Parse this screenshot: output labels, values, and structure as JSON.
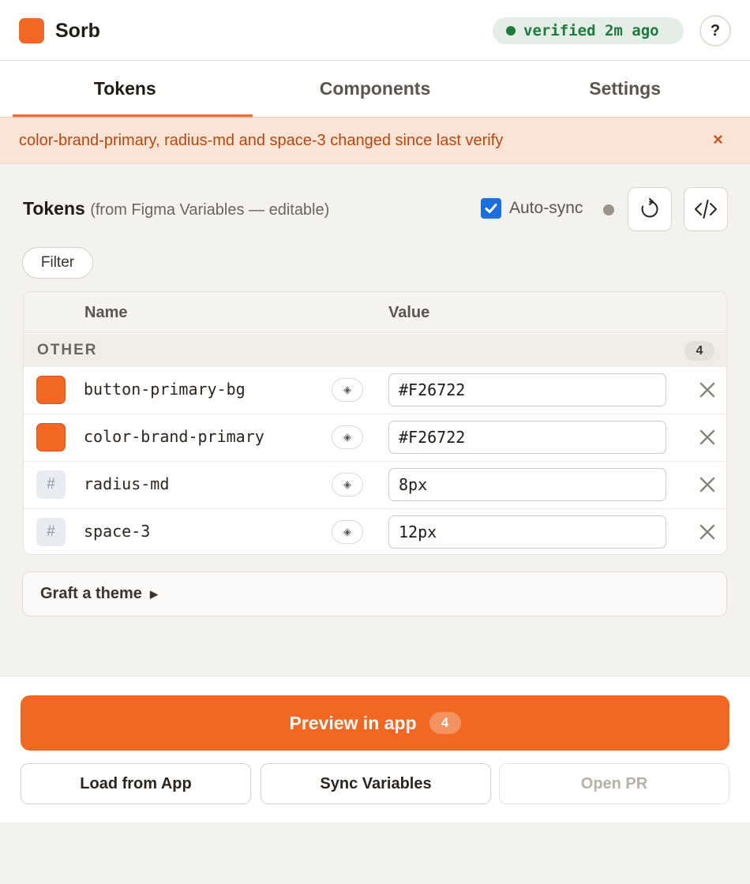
{
  "header": {
    "app_name": "Sorb",
    "status": "verified 2m ago",
    "help": "?"
  },
  "tabs": [
    {
      "label": "Tokens",
      "active": true
    },
    {
      "label": "Components",
      "active": false
    },
    {
      "label": "Settings",
      "active": false
    }
  ],
  "alert": {
    "message": "color-brand-primary, radius-md and space-3 changed since last verify",
    "close": "×"
  },
  "tokens_section": {
    "title": "Tokens",
    "subtitle": "(from Figma Variables — editable)",
    "autosync_label": "Auto-sync",
    "autosync_checked": true,
    "refresh_icon": "refresh-icon",
    "code_icon": "code-icon",
    "filter_label": "Filter"
  },
  "table": {
    "headers": {
      "name": "Name",
      "value": "Value"
    },
    "group": {
      "label": "OTHER",
      "count": "4"
    },
    "rows": [
      {
        "type": "color",
        "name": "button-primary-bg",
        "value": "#F26722",
        "alias": "◈"
      },
      {
        "type": "color",
        "name": "color-brand-primary",
        "value": "#F26722",
        "alias": "◈"
      },
      {
        "type": "number",
        "name": "radius-md",
        "value": "8px",
        "alias": "◈",
        "glyph": "#"
      },
      {
        "type": "number",
        "name": "space-3",
        "value": "12px",
        "alias": "◈",
        "glyph": "#"
      }
    ]
  },
  "graft": {
    "label": "Graft a theme",
    "caret": "▶"
  },
  "footer": {
    "preview_label": "Preview in app",
    "preview_count": "4",
    "load_label": "Load from App",
    "sync_label": "Sync Variables",
    "pr_label": "Open PR"
  },
  "colors": {
    "brand": "#F26722",
    "verified": "#1F7A3E",
    "checkbox": "#1A6FE0",
    "alert_bg": "#FBE3D6"
  }
}
